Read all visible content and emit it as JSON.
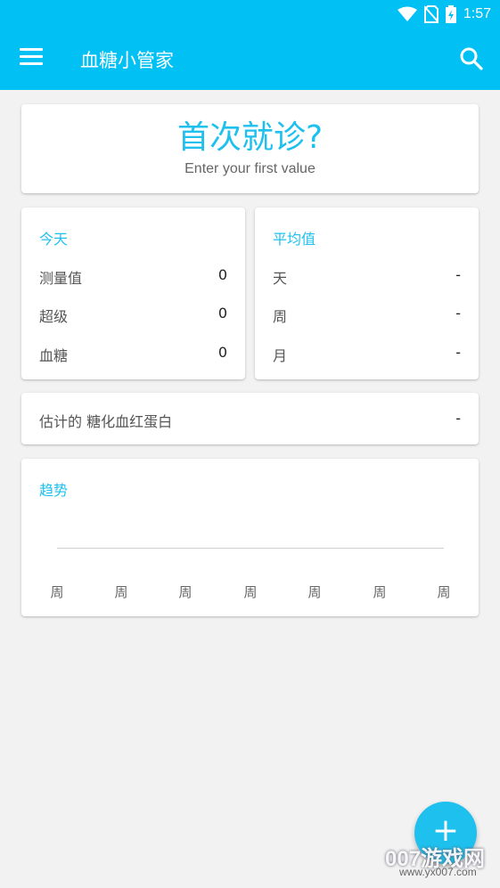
{
  "status_bar": {
    "time": "1:57",
    "icons": [
      "wifi-icon",
      "no-sim-icon",
      "battery-charging-icon"
    ]
  },
  "app_bar": {
    "title": "血糖小管家",
    "menu_icon": "menu-icon",
    "search_icon": "search-icon",
    "color": "#00c0f4"
  },
  "first_visit": {
    "headline": "首次就诊?",
    "subtitle": "Enter your first value"
  },
  "today": {
    "title": "今天",
    "rows": [
      {
        "label": "测量值",
        "value": "0"
      },
      {
        "label": "超级",
        "value": "0"
      },
      {
        "label": "血糖",
        "value": "0"
      }
    ]
  },
  "average": {
    "title": "平均值",
    "rows": [
      {
        "label": "天",
        "value": "-"
      },
      {
        "label": "周",
        "value": "-"
      },
      {
        "label": "月",
        "value": "-"
      }
    ]
  },
  "hba1c": {
    "label": "估计的 糖化血红蛋白",
    "value": "-"
  },
  "trend": {
    "title": "趋势",
    "ticks": [
      "周",
      "周",
      "周",
      "周",
      "周",
      "周",
      "周"
    ]
  },
  "fab": {
    "label": "+"
  },
  "watermark": {
    "text": "007游戏网",
    "url": "www.yx007.com"
  },
  "colors": {
    "accent": "#1ec0ee",
    "background": "#f2f2f2"
  }
}
